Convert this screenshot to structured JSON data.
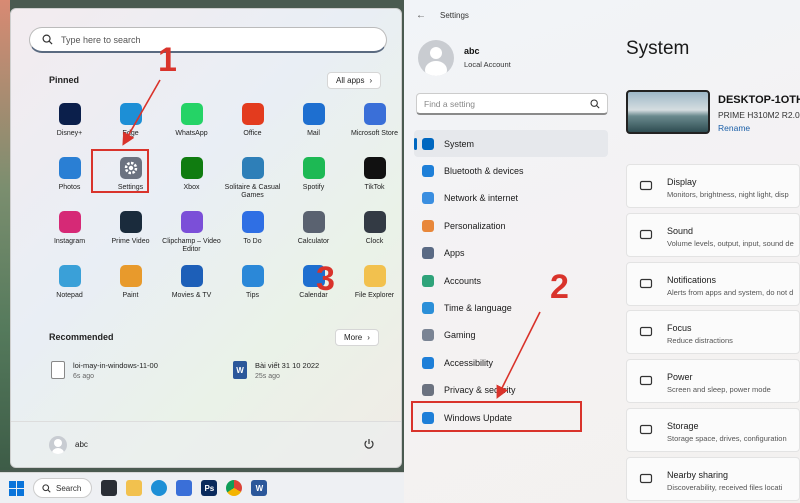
{
  "start_menu": {
    "search_placeholder": "Type here to search",
    "pinned_title": "Pinned",
    "all_apps_label": "All apps",
    "pinned_apps": [
      {
        "label": "Disney+",
        "icon": "disney-icon",
        "color": "#0b1f4b"
      },
      {
        "label": "Edge",
        "icon": "edge-icon",
        "color": "#1d8fd6"
      },
      {
        "label": "WhatsApp",
        "icon": "whatsapp-icon",
        "color": "#25d366"
      },
      {
        "label": "Office",
        "icon": "office-icon",
        "color": "#e33b1e"
      },
      {
        "label": "Mail",
        "icon": "mail-icon",
        "color": "#1e6fd0"
      },
      {
        "label": "Microsoft Store",
        "icon": "store-icon",
        "color": "#3a6fd8"
      },
      {
        "label": "Photos",
        "icon": "photos-icon",
        "color": "#2a7fd4"
      },
      {
        "label": "Settings",
        "icon": "gear-icon",
        "color": "#6b7280"
      },
      {
        "label": "Xbox",
        "icon": "xbox-icon",
        "color": "#107c10"
      },
      {
        "label": "Solitaire & Casual Games",
        "icon": "solitaire-icon",
        "color": "#2e7fb8"
      },
      {
        "label": "Spotify",
        "icon": "spotify-icon",
        "color": "#1db954"
      },
      {
        "label": "TikTok",
        "icon": "tiktok-icon",
        "color": "#111111"
      },
      {
        "label": "Instagram",
        "icon": "instagram-icon",
        "color": "#d62976"
      },
      {
        "label": "Prime Video",
        "icon": "prime-video-icon",
        "color": "#1a2b3c"
      },
      {
        "label": "Clipchamp – Video Editor",
        "icon": "clipchamp-icon",
        "color": "#7b4fd8"
      },
      {
        "label": "To Do",
        "icon": "todo-icon",
        "color": "#2f6fe4"
      },
      {
        "label": "Calculator",
        "icon": "calculator-icon",
        "color": "#5a6270"
      },
      {
        "label": "Clock",
        "icon": "clock-icon",
        "color": "#333a44"
      },
      {
        "label": "Notepad",
        "icon": "notepad-icon",
        "color": "#3aa0d8"
      },
      {
        "label": "Paint",
        "icon": "paint-icon",
        "color": "#e89a2c"
      },
      {
        "label": "Movies & TV",
        "icon": "movies-icon",
        "color": "#1d5fb8"
      },
      {
        "label": "Tips",
        "icon": "tips-icon",
        "color": "#2b88d8"
      },
      {
        "label": "Calendar",
        "icon": "calendar-icon",
        "color": "#1e6fd0"
      },
      {
        "label": "File Explorer",
        "icon": "folder-icon",
        "color": "#f2c14e"
      }
    ],
    "recommended_title": "Recommended",
    "more_label": "More",
    "recommended": [
      {
        "name": "loi-may-in-windows-11-00",
        "time": "6s ago"
      },
      {
        "name": "Bài viết 31 10 2022",
        "time": "25s ago"
      }
    ],
    "user_name": "abc"
  },
  "taskbar": {
    "search_label": "Search"
  },
  "settings": {
    "window_title": "Settings",
    "user_name": "abc",
    "account_type": "Local Account",
    "find_placeholder": "Find a setting",
    "nav": [
      {
        "label": "System",
        "color": "#0067c0"
      },
      {
        "label": "Bluetooth & devices",
        "color": "#1e7fd8"
      },
      {
        "label": "Network & internet",
        "color": "#3a8ee0"
      },
      {
        "label": "Personalization",
        "color": "#e8873a"
      },
      {
        "label": "Apps",
        "color": "#5a6a84"
      },
      {
        "label": "Accounts",
        "color": "#2fa37a"
      },
      {
        "label": "Time & language",
        "color": "#2b8fd8"
      },
      {
        "label": "Gaming",
        "color": "#7a8494"
      },
      {
        "label": "Accessibility",
        "color": "#1e7fd8"
      },
      {
        "label": "Privacy & security",
        "color": "#6b7280"
      },
      {
        "label": "Windows Update",
        "color": "#1e7fd8"
      }
    ],
    "page_title": "System",
    "device_name": "DESKTOP-1OTH",
    "device_model": "PRIME H310M2 R2.0",
    "rename_label": "Rename",
    "cards": [
      {
        "title": "Display",
        "subtitle": "Monitors, brightness, night light, disp",
        "icon": "display-icon"
      },
      {
        "title": "Sound",
        "subtitle": "Volume levels, output, input, sound de",
        "icon": "sound-icon"
      },
      {
        "title": "Notifications",
        "subtitle": "Alerts from apps and system, do not d",
        "icon": "notifications-icon"
      },
      {
        "title": "Focus",
        "subtitle": "Reduce distractions",
        "icon": "focus-icon"
      },
      {
        "title": "Power",
        "subtitle": "Screen and sleep, power mode",
        "icon": "power-icon"
      },
      {
        "title": "Storage",
        "subtitle": "Storage space, drives, configuration",
        "icon": "storage-icon"
      },
      {
        "title": "Nearby sharing",
        "subtitle": "Discoverability, received files locati",
        "icon": "share-icon"
      }
    ]
  },
  "annotations": {
    "step1": "1",
    "step2": "2",
    "step3": "3",
    "accent_color": "#d9332b"
  }
}
